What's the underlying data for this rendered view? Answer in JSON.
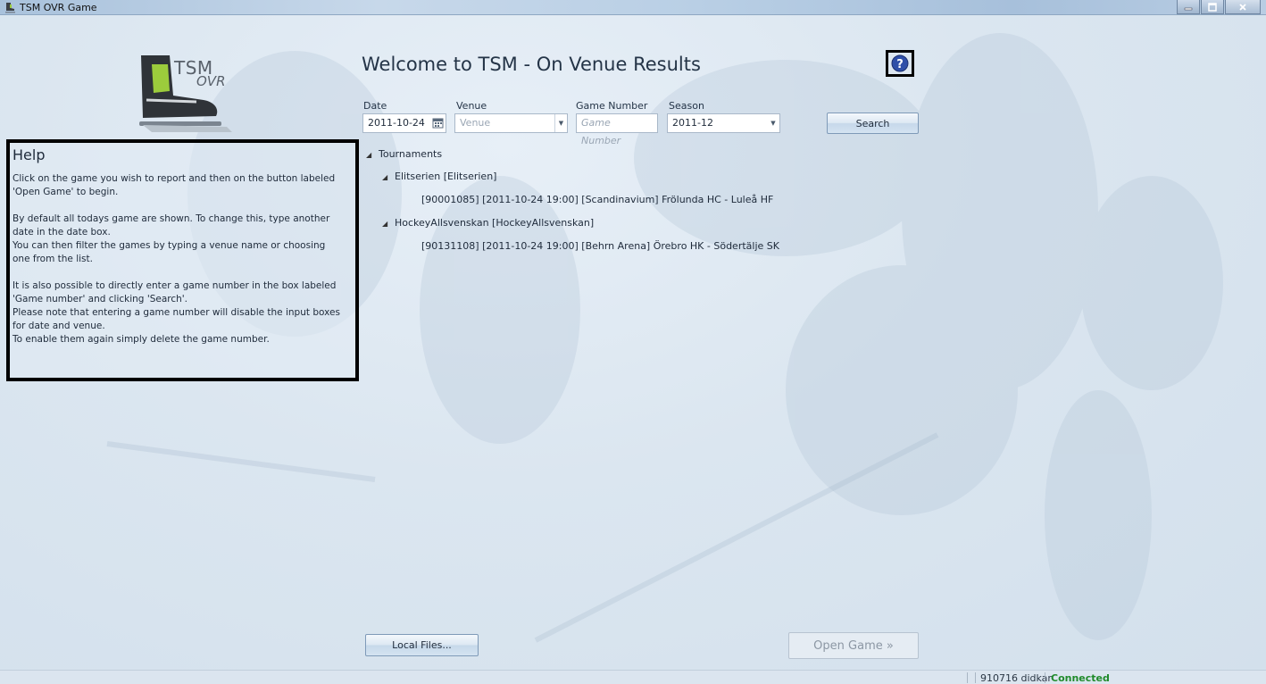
{
  "window": {
    "title": "TSM OVR Game",
    "controls": [
      "minimize",
      "maximize",
      "close"
    ]
  },
  "logo": {
    "line1": "TSM",
    "line2": "OVR"
  },
  "heading": "Welcome to TSM - On Venue Results",
  "help_button": {
    "icon": "question-circle-icon"
  },
  "form": {
    "date": {
      "label": "Date",
      "value": "2011-10-24"
    },
    "venue": {
      "label": "Venue",
      "placeholder": "Venue"
    },
    "game_number": {
      "label": "Game Number",
      "placeholder": "Game Number"
    },
    "season": {
      "label": "Season",
      "value": "2011-12"
    },
    "search_label": "Search"
  },
  "help": {
    "title": "Help",
    "paragraphs": [
      [
        "Click on the game you wish to report and then on the button labeled",
        "'Open Game' to begin."
      ],
      [
        "By default all todays game are shown. To change this, type another",
        "date in the date box.",
        "You can then filter the games by typing a venue name or choosing",
        "one from the list."
      ],
      [
        "It is also possible to directly enter a game number in the box labeled",
        "'Game number' and clicking 'Search'.",
        "Please note that entering a game number will disable the input boxes",
        "for date and venue.",
        "To enable them again simply delete the game number."
      ]
    ]
  },
  "tree": {
    "root": "Tournaments",
    "groups": [
      {
        "label": "Elitserien [Elitserien]",
        "games": [
          "[90001085] [2011-10-24 19:00] [Scandinavium] Frölunda HC - Luleå HF"
        ]
      },
      {
        "label": "HockeyAllsvenskan [HockeyAllsvenskan]",
        "games": [
          "[90131108] [2011-10-24 19:00] [Behrn Arena] Örebro HK - Södertälje SK"
        ]
      }
    ]
  },
  "buttons": {
    "local_files": "Local Files...",
    "open_game": "Open Game »"
  },
  "status": {
    "user": "910716 didkar",
    "connection": "Connected",
    "connection_color": "#1f8a2a"
  }
}
